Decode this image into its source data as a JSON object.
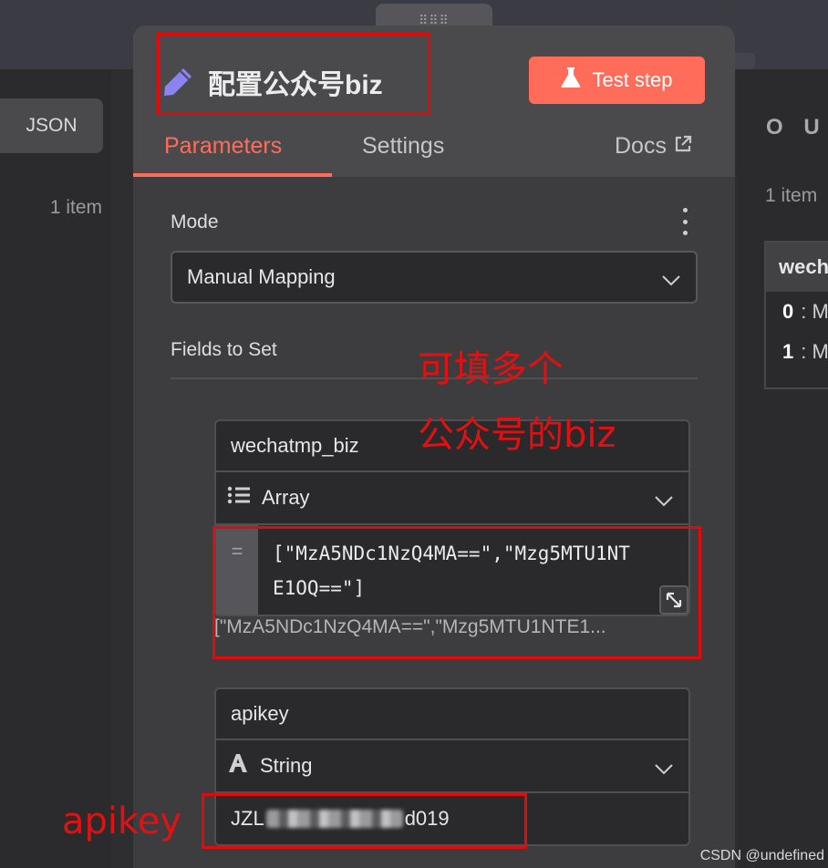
{
  "left_panel": {
    "json_tab": "JSON",
    "item_count": "1 item"
  },
  "right_panel": {
    "title": "O U T",
    "item_count": "1 item",
    "table_header": "wech",
    "rows": [
      {
        "index": "0",
        "value": ": M"
      },
      {
        "index": "1",
        "value": ": M"
      }
    ]
  },
  "node": {
    "drag_handle": "⠿⠿⠿",
    "title": "配置公众号biz",
    "title_icon": "pencil-icon",
    "test_button": "Test step",
    "tabs": {
      "parameters": "Parameters",
      "settings": "Settings",
      "docs": "Docs"
    },
    "mode": {
      "label": "Mode",
      "value": "Manual Mapping"
    },
    "fields_label": "Fields to Set",
    "fields": [
      {
        "name": "wechatmp_biz",
        "type": "Array",
        "type_icon": "list-icon",
        "value": "[\"MzA5NDc1NzQ4MA==\",\"Mzg5MTU1NTE1OQ==\"]",
        "value_line1": "[\"MzA5NDc1NzQ4MA==\",\"Mzg5MTU1NT",
        "value_line2": "E1OQ==\"]",
        "preview": "[\"MzA5NDc1NzQ4MA==\",\"Mzg5MTU1NTE1..."
      },
      {
        "name": "apikey",
        "type": "String",
        "type_icon": "string-type-icon",
        "value_prefix": "JZL",
        "value_suffix": "d019"
      }
    ]
  },
  "annotations": {
    "note_line1": "可填多个",
    "note_line2": "公众号的biz",
    "apikey": "apikey"
  },
  "watermark": "CSDN @undefined",
  "colors": {
    "accent": "#ff6d5a",
    "annotation_red": "#e20a0a"
  }
}
